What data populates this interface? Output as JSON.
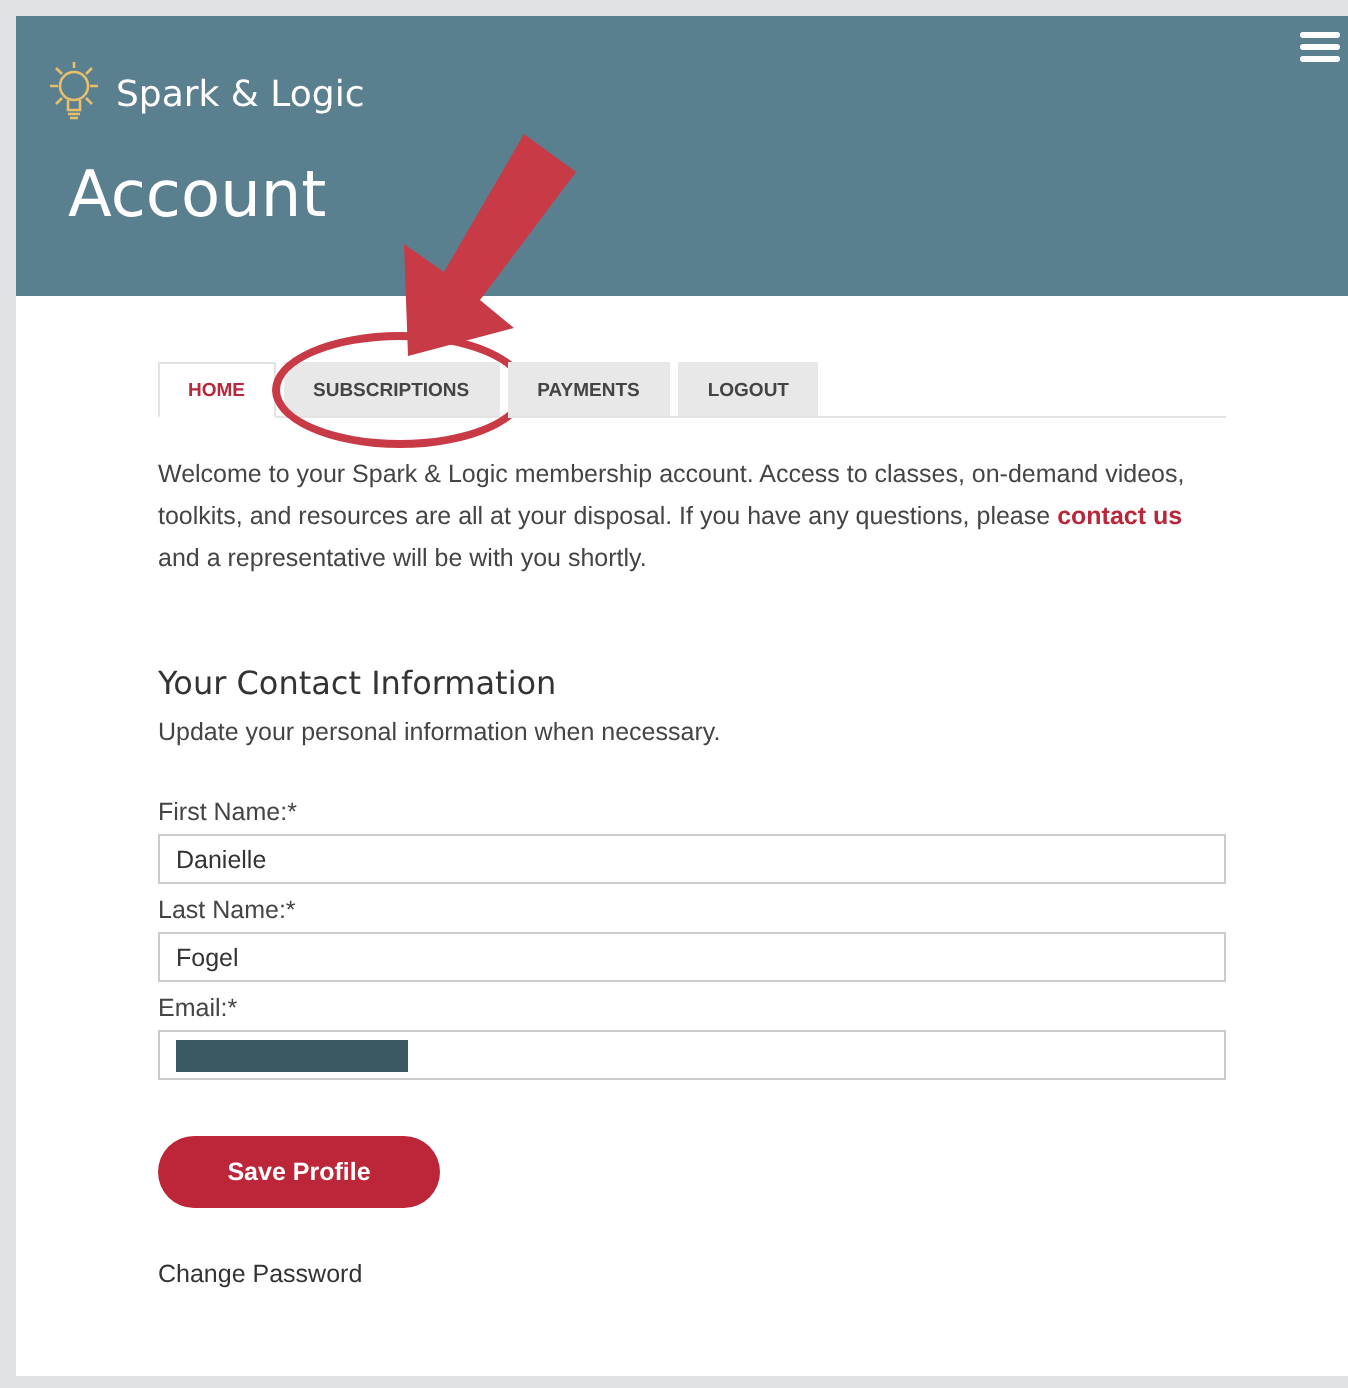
{
  "brand": {
    "name": "Spark & Logic"
  },
  "header": {
    "title": "Account"
  },
  "tabs": [
    {
      "label": "HOME",
      "selected": true,
      "circled": false
    },
    {
      "label": "SUBSCRIPTIONS",
      "selected": false,
      "circled": true
    },
    {
      "label": "PAYMENTS",
      "selected": false,
      "circled": false
    },
    {
      "label": "LOGOUT",
      "selected": false,
      "circled": false
    }
  ],
  "intro": "Welcome to your Spark & Logic membership account. Access to classes, on-demand videos, toolkits, and resources are all at your disposal. If you have any questions, please **contact us** and a representative will be with you shortly.",
  "contact": {
    "heading": "Your Contact Information",
    "subtitle": "Update your personal information when necessary."
  },
  "fields": [
    {
      "label": "First Name:*",
      "value": "Danielle",
      "redacted": false
    },
    {
      "label": "Last Name:*",
      "value": "Fogel",
      "redacted": false
    },
    {
      "label": "Email:*",
      "redacted": true
    }
  ],
  "save_button": "Save Profile",
  "change_password": "Change Password",
  "annotation": {
    "arrow": true
  }
}
